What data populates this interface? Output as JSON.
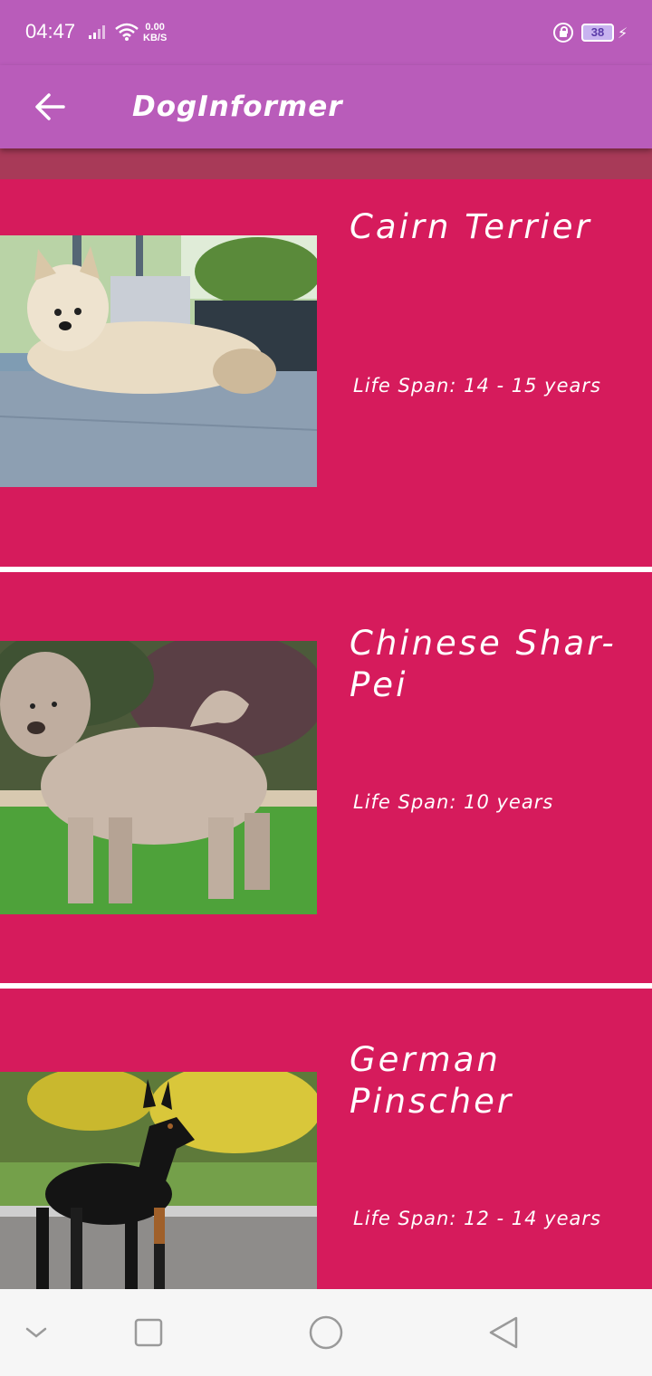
{
  "status_bar": {
    "time": "04:47",
    "net_speed_value": "0.00",
    "net_speed_unit": "KB/S",
    "battery_level": "38",
    "icons": [
      "signal-icon",
      "wifi-icon",
      "lock-icon",
      "battery-icon",
      "charging-icon"
    ]
  },
  "app_bar": {
    "title": "DogInformer",
    "back_icon": "arrow-left-icon"
  },
  "colors": {
    "app_bar": "#b95cba",
    "card": "#d61b5c",
    "text": "#ffffff"
  },
  "breeds": [
    {
      "name": "Cairn Terrier",
      "life_span": "Life Span: 14 - 15 years",
      "photo": "cairn-terrier-photo"
    },
    {
      "name": "Chinese Shar-Pei",
      "life_span": "Life Span: 10 years",
      "photo": "shar-pei-photo"
    },
    {
      "name": "German Pinscher",
      "life_span": "Life Span: 12 - 14 years",
      "photo": "german-pinscher-photo"
    }
  ],
  "nav_bar": {
    "icons": [
      "chevron-down-icon",
      "recents-icon",
      "home-icon",
      "back-triangle-icon"
    ]
  }
}
